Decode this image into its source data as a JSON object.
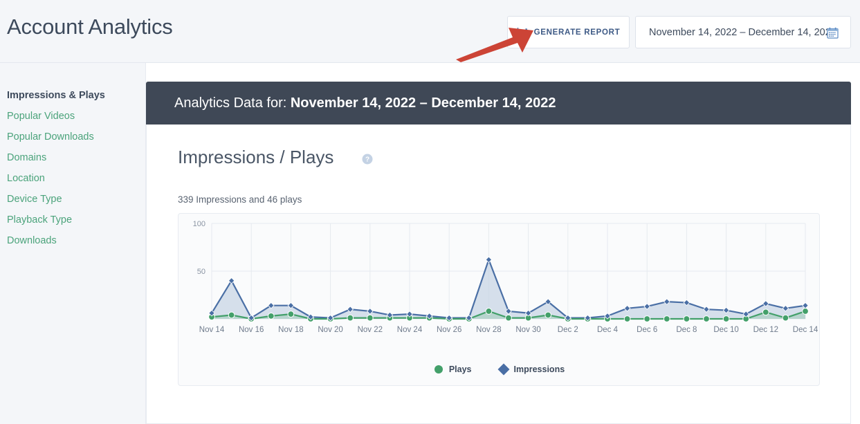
{
  "header": {
    "title": "Account Analytics",
    "generate_report_label": "GENERATE REPORT",
    "generate_report_icon": "line-chart-icon",
    "date_range_value": "November 14, 2022 – December 14, 2022",
    "date_range_icon": "calendar-icon",
    "annotation_icon": "red-arrow-pointer"
  },
  "sidebar": {
    "items": [
      {
        "label": "Impressions & Plays",
        "active": true
      },
      {
        "label": "Popular Videos",
        "active": false
      },
      {
        "label": "Popular Downloads",
        "active": false
      },
      {
        "label": "Domains",
        "active": false
      },
      {
        "label": "Location",
        "active": false
      },
      {
        "label": "Device Type",
        "active": false
      },
      {
        "label": "Playback Type",
        "active": false
      },
      {
        "label": "Downloads",
        "active": false
      }
    ]
  },
  "main": {
    "data_header_prefix": "Analytics Data for:",
    "data_header_range": "November 14, 2022 – December 14, 2022",
    "section_title": "Impressions / Plays",
    "help_icon": "question-mark-circle-icon",
    "summary": "339 Impressions and 46 plays"
  },
  "colors": {
    "accent_green": "#4ba37b",
    "plays_green": "#43a06a",
    "impressions_blue": "#4a6fa5",
    "impressions_fill": "#c8d5e6",
    "dark_header": "#3f4856",
    "page_bg": "#f4f6f9",
    "arrow_red": "#cc4436"
  },
  "chart_data": {
    "type": "line",
    "title": "Impressions / Plays",
    "xlabel": "",
    "ylabel": "",
    "ylim": [
      0,
      100
    ],
    "yticks": [
      50,
      100
    ],
    "grid": true,
    "legend_position": "bottom",
    "x": [
      "Nov 14",
      "Nov 15",
      "Nov 16",
      "Nov 17",
      "Nov 18",
      "Nov 19",
      "Nov 20",
      "Nov 21",
      "Nov 22",
      "Nov 23",
      "Nov 24",
      "Nov 25",
      "Nov 26",
      "Nov 27",
      "Nov 28",
      "Nov 29",
      "Nov 30",
      "Dec 1",
      "Dec 2",
      "Dec 3",
      "Dec 4",
      "Dec 5",
      "Dec 6",
      "Dec 7",
      "Dec 8",
      "Dec 9",
      "Dec 10",
      "Dec 11",
      "Dec 12",
      "Dec 13",
      "Dec 14"
    ],
    "tick_labels": [
      "Nov 14",
      "Nov 16",
      "Nov 18",
      "Nov 20",
      "Nov 22",
      "Nov 24",
      "Nov 26",
      "Nov 28",
      "Nov 30",
      "Dec 2",
      "Dec 4",
      "Dec 6",
      "Dec 8",
      "Dec 10",
      "Dec 12",
      "Dec 14"
    ],
    "series": [
      {
        "name": "Impressions",
        "color": "#4a6fa5",
        "marker": "diamond",
        "values": [
          6,
          40,
          1,
          14,
          14,
          2,
          1,
          10,
          8,
          4,
          5,
          3,
          1,
          1,
          62,
          8,
          6,
          18,
          1,
          1,
          3,
          11,
          13,
          18,
          17,
          10,
          9,
          5,
          16,
          11,
          14
        ]
      },
      {
        "name": "Plays",
        "color": "#43a06a",
        "marker": "circle",
        "values": [
          2,
          4,
          0,
          3,
          5,
          0,
          0,
          1,
          1,
          1,
          1,
          1,
          0,
          0,
          8,
          1,
          1,
          4,
          0,
          0,
          0,
          0,
          0,
          0,
          0,
          0,
          0,
          0,
          7,
          1,
          8
        ]
      }
    ]
  },
  "legend": {
    "plays_label": "Plays",
    "plays_icon": "green-circle-icon",
    "impressions_label": "Impressions",
    "impressions_icon": "blue-diamond-icon"
  }
}
